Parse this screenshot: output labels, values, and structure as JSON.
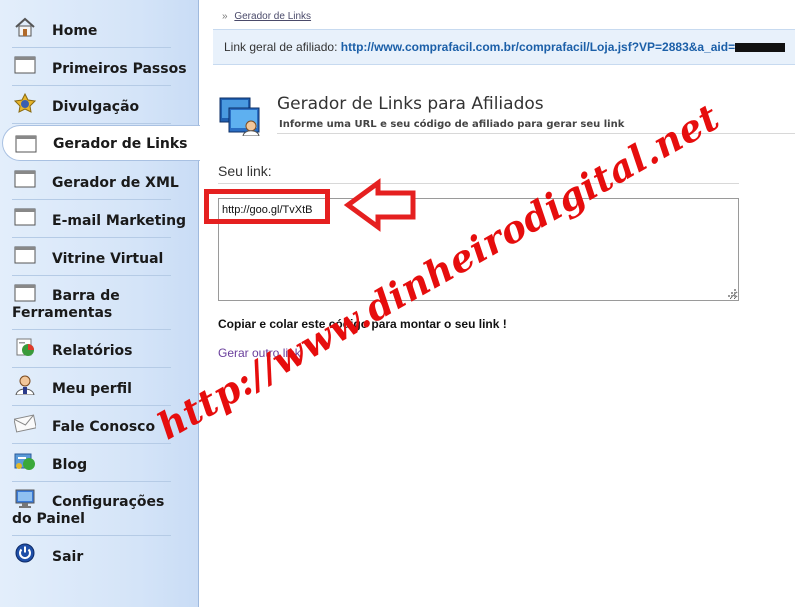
{
  "sidebar": {
    "items": [
      {
        "label": "Home",
        "icon": "house-icon"
      },
      {
        "label": "Primeiros Passos",
        "icon": "window-icon"
      },
      {
        "label": "Divulgação",
        "icon": "star-badge-icon"
      },
      {
        "label": "Gerador de Links",
        "icon": "window-icon",
        "active": true
      },
      {
        "label": "Gerador de XML",
        "icon": "window-icon"
      },
      {
        "label": "E-mail Marketing",
        "icon": "window-icon"
      },
      {
        "label": "Vitrine Virtual",
        "icon": "window-icon"
      },
      {
        "label": "Barra de Ferramentas",
        "icon": "window-icon"
      },
      {
        "label": "Relatórios",
        "icon": "reports-icon"
      },
      {
        "label": "Meu perfil",
        "icon": "user-icon"
      },
      {
        "label": "Fale Conosco",
        "icon": "envelope-icon"
      },
      {
        "label": "Blog",
        "icon": "blog-icon"
      },
      {
        "label": "Configurações do Painel",
        "icon": "monitor-icon"
      },
      {
        "label": "Sair",
        "icon": "power-icon"
      }
    ]
  },
  "breadcrumb": {
    "separator": "»",
    "current": "Gerador de Links"
  },
  "affiliate": {
    "label": "Link geral de afiliado:",
    "url": "http://www.comprafacil.com.br/comprafacil/Loja.jsf?VP=2883&a_aid="
  },
  "page": {
    "title": "Gerador de Links para Afiliados",
    "subtitle": "Informe uma URL e seu código de afiliado para gerar seu link"
  },
  "form": {
    "link_label": "Seu link:",
    "link_value": "http://goo.gl/TvXtB",
    "copy_hint": "Copiar e colar este código para montar o seu link !",
    "generate_another": "Gerar outro link"
  },
  "watermark": {
    "text": "http://www.dinheirodigital.net"
  },
  "colors": {
    "sidebar_bg": "#d4e4f8",
    "annotation_red": "#e52020",
    "url_blue": "#1b5fa8",
    "link_purple": "#6a3f9c"
  }
}
